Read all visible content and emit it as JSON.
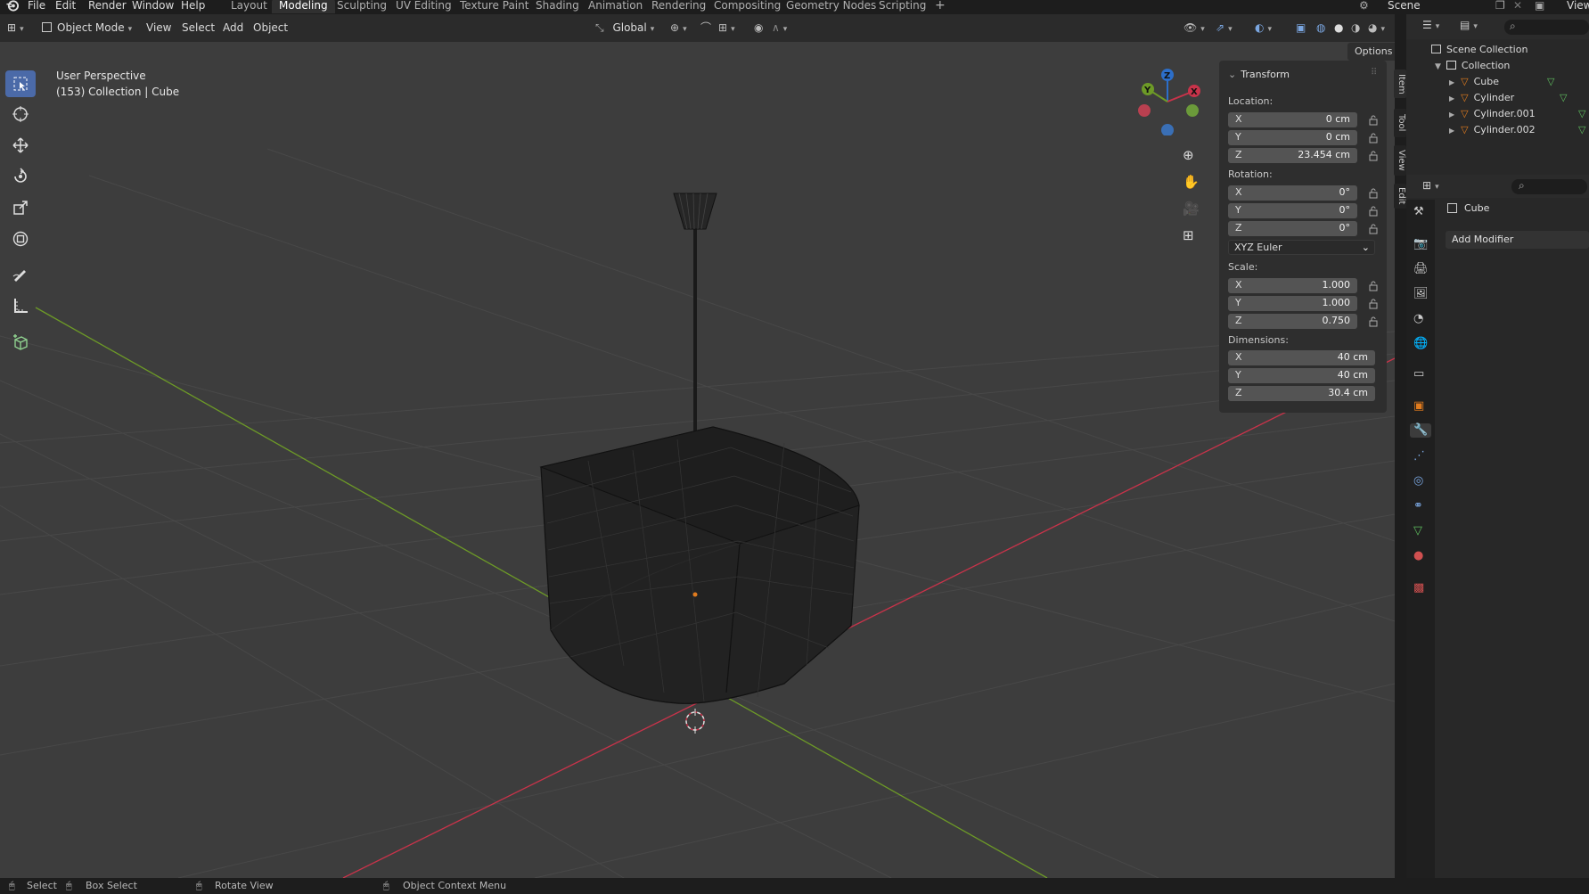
{
  "topbar": {
    "menus": [
      "File",
      "Edit",
      "Render",
      "Window",
      "Help"
    ],
    "workspaces": [
      "Layout",
      "Modeling",
      "Sculpting",
      "UV Editing",
      "Texture Paint",
      "Shading",
      "Animation",
      "Rendering",
      "Compositing",
      "Geometry Nodes",
      "Scripting",
      "+"
    ],
    "active_workspace": "Modeling",
    "scene_label": "Scene",
    "view_label": "View"
  },
  "header": {
    "mode": "Object Mode",
    "view": "View",
    "select": "Select",
    "add": "Add",
    "object": "Object",
    "transform_orientation": "Global",
    "options": "Options"
  },
  "viewport": {
    "perspective": "User Perspective",
    "context": "(153) Collection | Cube"
  },
  "transform_panel": {
    "title": "Transform",
    "location_label": "Location:",
    "location": [
      {
        "axis": "X",
        "value": "0 cm"
      },
      {
        "axis": "Y",
        "value": "0 cm"
      },
      {
        "axis": "Z",
        "value": "23.454 cm"
      }
    ],
    "rotation_label": "Rotation:",
    "rotation": [
      {
        "axis": "X",
        "value": "0°"
      },
      {
        "axis": "Y",
        "value": "0°"
      },
      {
        "axis": "Z",
        "value": "0°"
      }
    ],
    "rotation_mode": "XYZ Euler",
    "scale_label": "Scale:",
    "scale": [
      {
        "axis": "X",
        "value": "1.000"
      },
      {
        "axis": "Y",
        "value": "1.000"
      },
      {
        "axis": "Z",
        "value": "0.750"
      }
    ],
    "dimensions_label": "Dimensions:",
    "dimensions": [
      {
        "axis": "X",
        "value": "40 cm"
      },
      {
        "axis": "Y",
        "value": "40 cm"
      },
      {
        "axis": "Z",
        "value": "30.4 cm"
      }
    ]
  },
  "side_tabs": [
    "Item",
    "Tool",
    "View",
    "Edit"
  ],
  "outliner": {
    "root": "Scene Collection",
    "collection": "Collection",
    "items": [
      "Cube",
      "Cylinder",
      "Cylinder.001",
      "Cylinder.002"
    ]
  },
  "properties": {
    "object_name": "Cube",
    "add_modifier": "Add Modifier"
  },
  "statusbar": {
    "items": [
      "Select",
      "Box Select",
      "Rotate View",
      "Object Context Menu"
    ]
  },
  "colors": {
    "x_axis": "#c8334a",
    "y_axis": "#6d9a27",
    "z_axis": "#2c6ec9",
    "active_tool": "#4b6aa8",
    "orange": "#e07b1e"
  }
}
